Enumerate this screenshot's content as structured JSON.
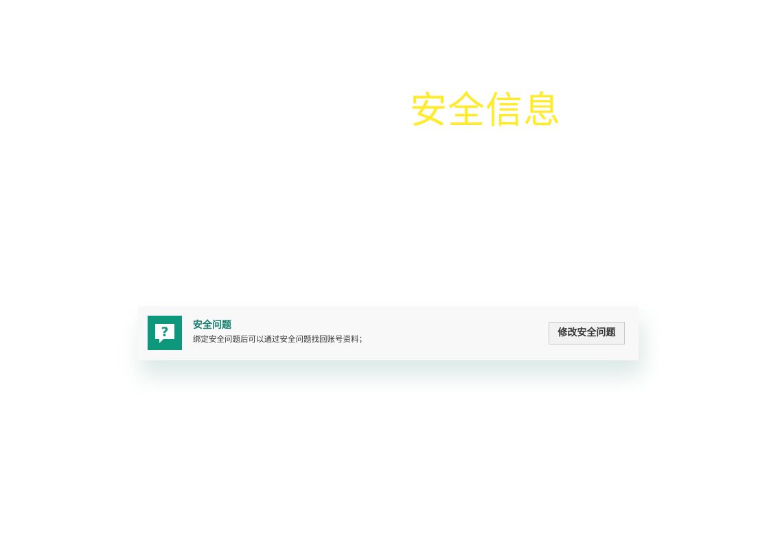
{
  "page": {
    "title": "安全信息"
  },
  "security_question": {
    "icon": "question-chat-icon",
    "title": "安全问题",
    "description": "绑定安全问题后可以通过安全问题找回账号资料；",
    "button_label": "修改安全问题"
  },
  "colors": {
    "page_background": "#ffffff",
    "title_yellow": "#ffeb2a",
    "accent_green": "#0d987b",
    "card_background": "#f8f8f8",
    "button_background": "#f2f2f2"
  }
}
